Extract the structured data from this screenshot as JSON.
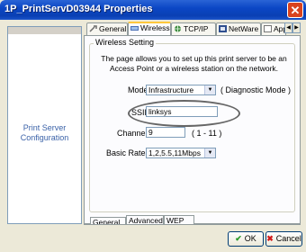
{
  "window": {
    "title": "1P_PrintServD03944 Properties",
    "close_glyph": "✕"
  },
  "sidebar": {
    "item": "Print Server Configuration"
  },
  "tabs": [
    {
      "label": "General",
      "icon": "wrench-icon"
    },
    {
      "label": "Wireless",
      "icon": "wireless-icon"
    },
    {
      "label": "TCP/IP",
      "icon": "network-icon"
    },
    {
      "label": "NetWare",
      "icon": "netware-icon"
    },
    {
      "label": "Apple",
      "icon": "apple-icon"
    }
  ],
  "wireless": {
    "group_title": "Wireless Setting",
    "description": "The page allows you to set up this print server to be an Access Point or a wireless station on the network.",
    "mode_label": "Mode",
    "mode_value": "Infrastructure",
    "diag_label": "( Diagnostic Mode )",
    "ssid_label": "SSID",
    "ssid_value": "linksys",
    "channel_label": "Channel",
    "channel_value": "9",
    "channel_range": "( 1 - 11 )",
    "rates_label": "Basic Rates",
    "rates_value": "1,2,5.5,11Mbps"
  },
  "subtabs": [
    "General",
    "Advanced",
    "WEP"
  ],
  "buttons": {
    "ok": "OK",
    "cancel": "Cancel"
  },
  "colors": {
    "ok_check": "#2a9a2a",
    "cancel_x": "#d21c1c",
    "active_tab_accent": "#ffc83c"
  }
}
